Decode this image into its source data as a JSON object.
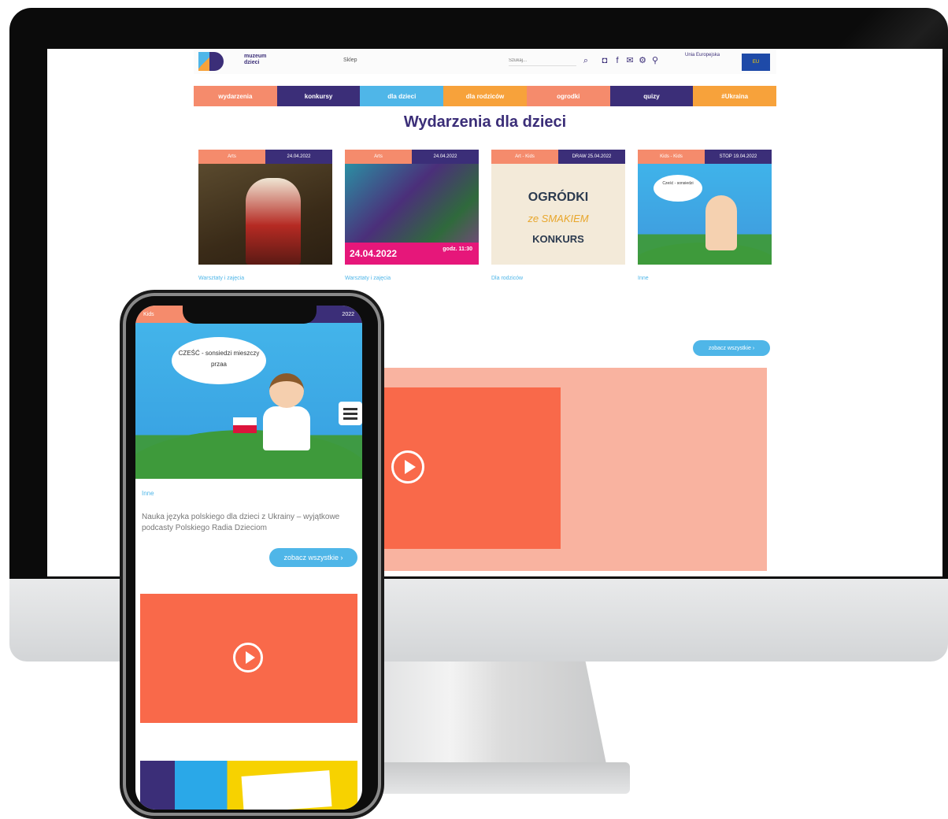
{
  "site": {
    "logo_text": "muzeum dzieci",
    "top_link": "Sklep",
    "search_placeholder": "Szukaj...",
    "eu_text": "Unia Europejska",
    "eu_flag_label": "EU",
    "menu": [
      {
        "label": "wydarzenia",
        "color": "#f58b6c"
      },
      {
        "label": "konkursy",
        "color": "#3b2e78"
      },
      {
        "label": "dla dzieci",
        "color": "#4fb6e8"
      },
      {
        "label": "dla rodziców",
        "color": "#f7a23b"
      },
      {
        "label": "ogrodki",
        "color": "#f58b6c"
      },
      {
        "label": "quizy",
        "color": "#3b2e78"
      },
      {
        "label": "#Ukraina",
        "color": "#f7a23b"
      }
    ],
    "section_title": "Wydarzenia dla dzieci",
    "cards": [
      {
        "tag_left": "Arts",
        "tag_right": "24.04.2022",
        "category": "Warsztaty i zajęcia",
        "description": ""
      },
      {
        "tag_left": "Arts",
        "tag_right": "24.04.2022",
        "date_banner": "24.04.2022",
        "hour": "godz. 11:30",
        "category": "Warsztaty i zajęcia",
        "description": ""
      },
      {
        "tag_left": "Art - Kids",
        "tag_right": "DRAW 25.04.2022",
        "image_line1": "OGRÓDKI",
        "image_line2": "ze SMAKIEM",
        "image_line3": "KONKURS",
        "category": "Dla rodziców",
        "description": ""
      },
      {
        "tag_left": "Kids - Kids",
        "tag_right": "STOP 19.04.2022",
        "bubble": "Cześć - sonsiedzi",
        "category": "Inne",
        "description": ""
      }
    ],
    "see_all": "zobacz wszystkie ›"
  },
  "phone": {
    "tag_left": "Kids",
    "tag_right": "2022",
    "bubble": "CZEŚĆ - sonsiedzi mieszczy przaa",
    "category": "Inne",
    "description": "Nauka języka polskiego dla dzieci z Ukrainy – wyjątkowe podcasty Polskiego Radia Dzieciom",
    "see_all": "zobacz wszystkie ›"
  }
}
